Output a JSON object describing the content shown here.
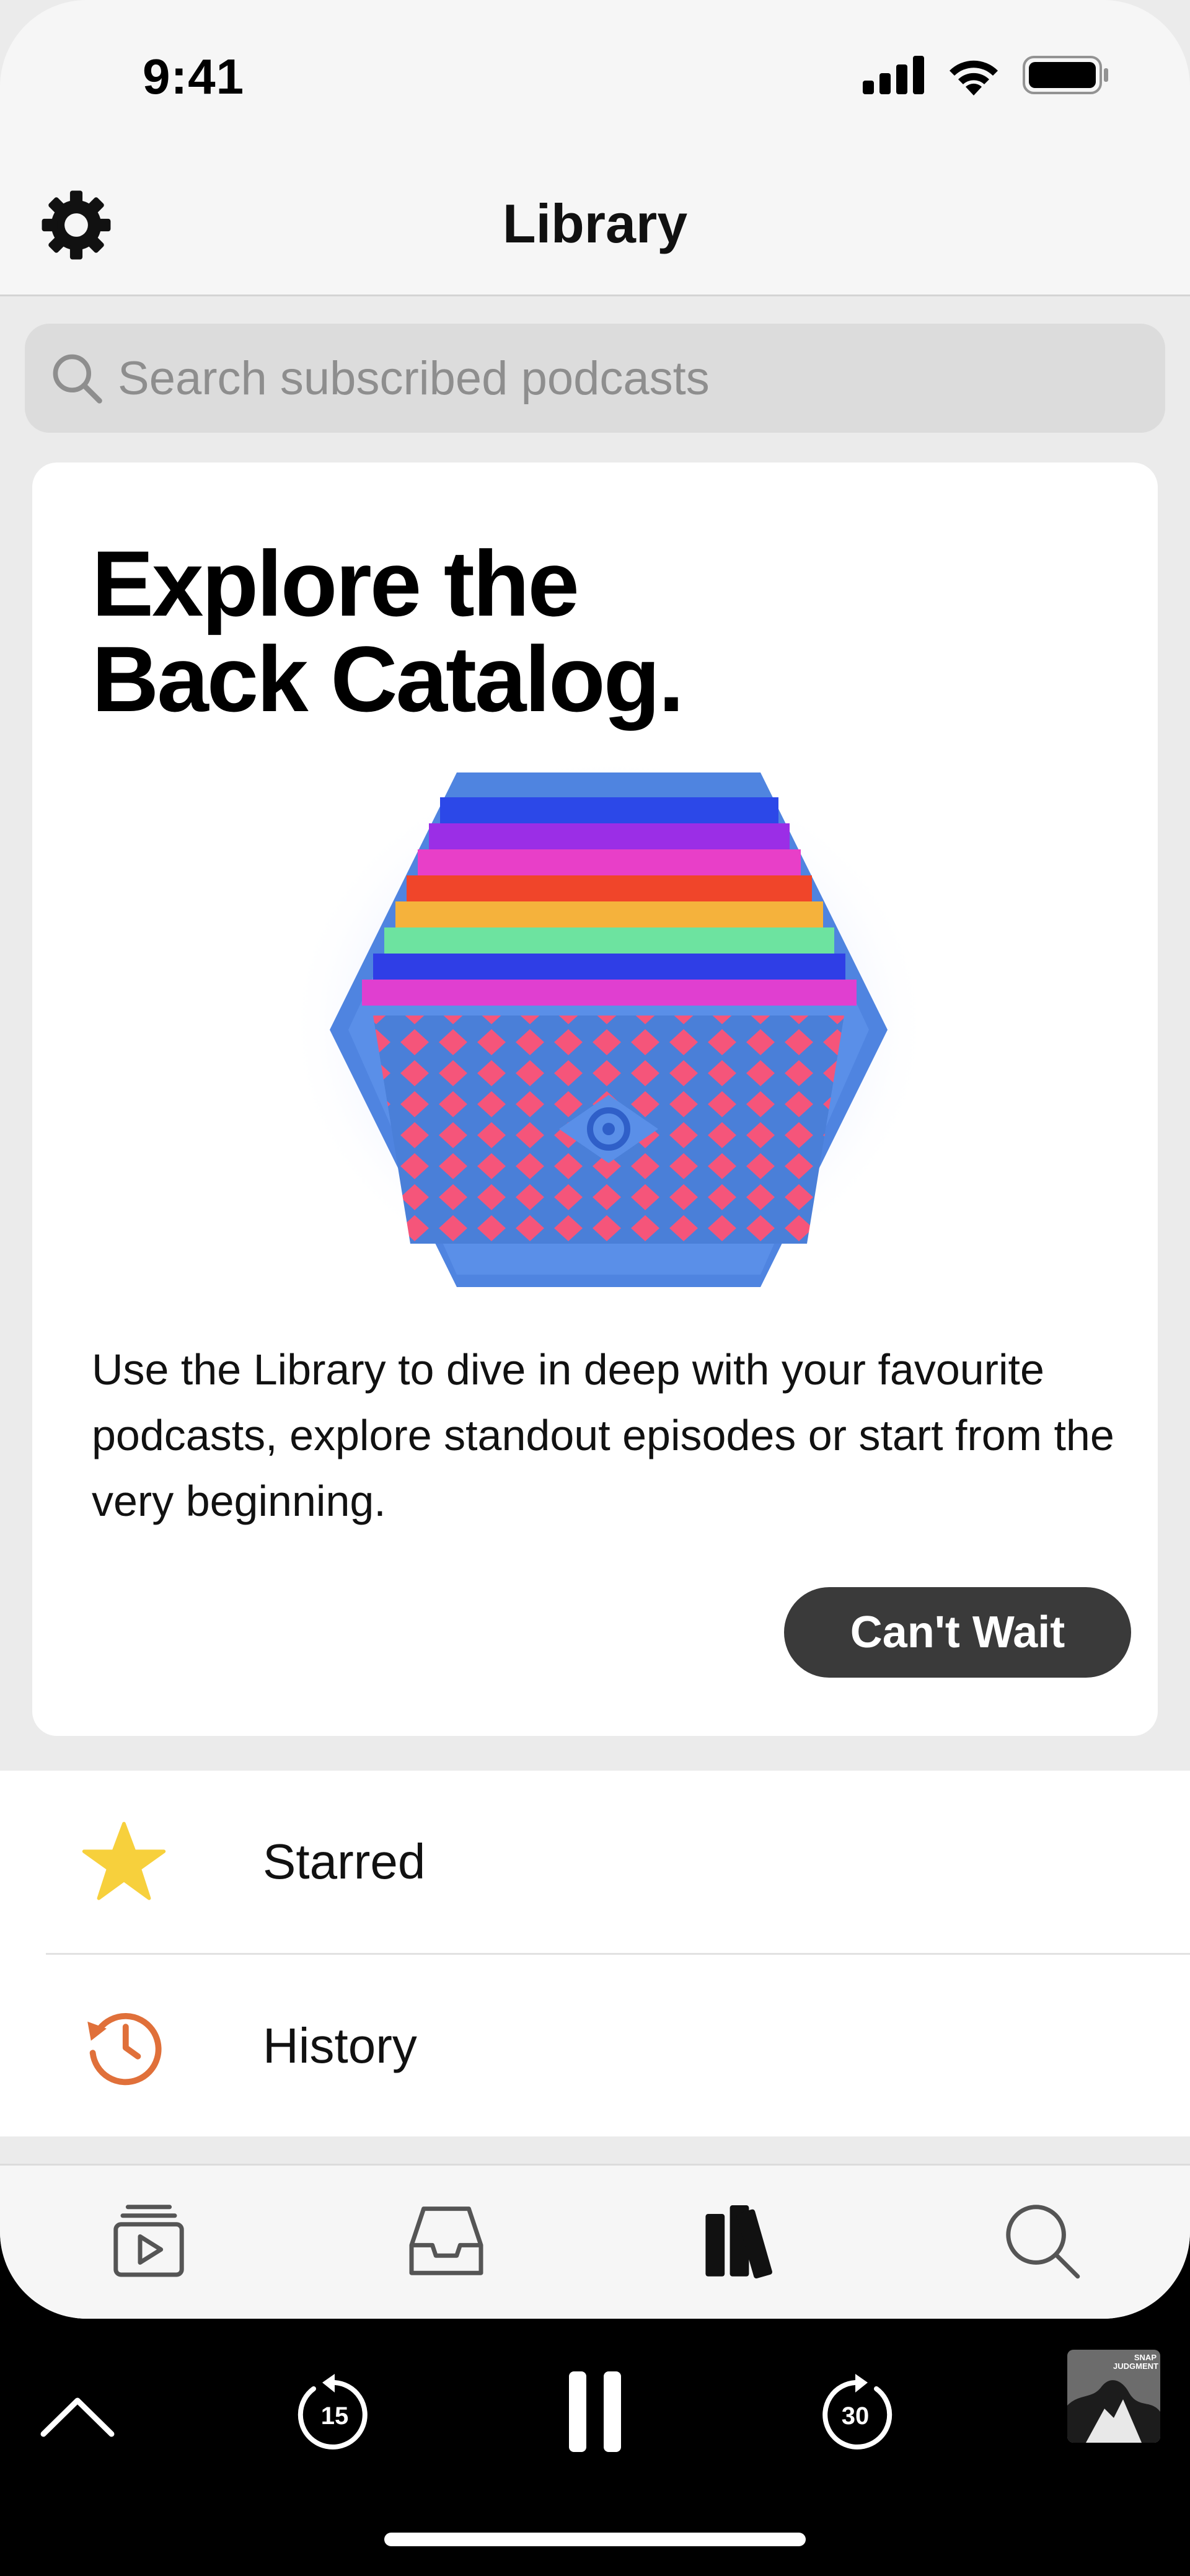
{
  "status_bar": {
    "time": "9:41"
  },
  "nav": {
    "title": "Library"
  },
  "search": {
    "placeholder": "Search subscribed podcasts"
  },
  "promo_card": {
    "title_line1": "Explore the",
    "title_line2": "Back Catalog.",
    "body": "Use the Library to dive in deep with your favourite podcasts, explore standout episodes or start from the very beginning.",
    "button_label": "Can't Wait",
    "art_stripe_colors": [
      "#2c48e8",
      "#9b2ee6",
      "#e83fc8",
      "#f0452a",
      "#f5b23c",
      "#6de3a0",
      "#2f3ee6",
      "#e03fd0"
    ]
  },
  "library_items": [
    {
      "label": "Starred",
      "icon": "star-icon",
      "color": "#f7d03c"
    },
    {
      "label": "History",
      "icon": "history-icon",
      "color": "#e0703a"
    }
  ],
  "tab_bar": {
    "tabs": [
      {
        "name": "up-next",
        "icon": "play-stack-icon",
        "active": false
      },
      {
        "name": "inbox",
        "icon": "inbox-icon",
        "active": false
      },
      {
        "name": "library",
        "icon": "library-icon",
        "active": true
      },
      {
        "name": "search",
        "icon": "search-icon",
        "active": false
      }
    ]
  },
  "player": {
    "skip_back_seconds": "15",
    "skip_forward_seconds": "30",
    "state": "playing",
    "artwork_text": "SNAP JUDGMENT"
  }
}
